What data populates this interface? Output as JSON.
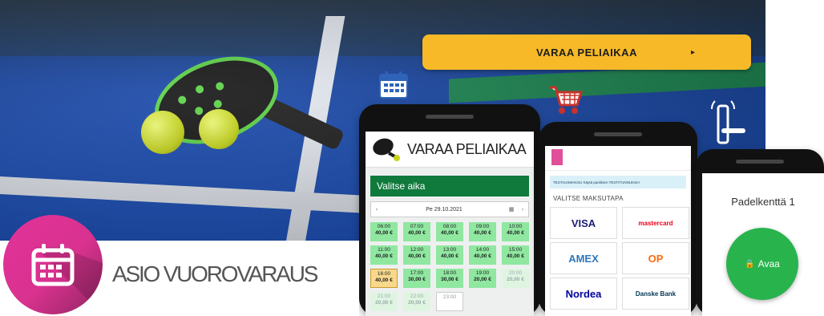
{
  "cta": {
    "label": "VARAA PELIAIKAA",
    "arrow": "▸"
  },
  "brand": {
    "name": "ASIO VUOROVARAUS",
    "accent": "#e2329a"
  },
  "phone_booking": {
    "title": "VARAA PELIAIKAA",
    "choose_label": "Valitse aika",
    "date": "Pe 29.10.2021",
    "prev": "‹",
    "next": "›",
    "slots": [
      {
        "time": "06:00",
        "price": "40,00 €",
        "state": "free"
      },
      {
        "time": "07:00",
        "price": "40,00 €",
        "state": "free"
      },
      {
        "time": "08:00",
        "price": "40,00 €",
        "state": "free"
      },
      {
        "time": "09:00",
        "price": "40,00 €",
        "state": "free"
      },
      {
        "time": "10:00",
        "price": "40,00 €",
        "state": "free"
      },
      {
        "time": "11:00",
        "price": "40,00 €",
        "state": "free"
      },
      {
        "time": "12:00",
        "price": "40,00 €",
        "state": "free"
      },
      {
        "time": "13:00",
        "price": "40,00 €",
        "state": "free"
      },
      {
        "time": "14:00",
        "price": "40,00 €",
        "state": "free"
      },
      {
        "time": "15:00",
        "price": "40,00 €",
        "state": "free"
      },
      {
        "time": "16:00",
        "price": "40,00 €",
        "state": "selected"
      },
      {
        "time": "17:00",
        "price": "30,00 €",
        "state": "free"
      },
      {
        "time": "18:00",
        "price": "30,00 €",
        "state": "free"
      },
      {
        "time": "19:00",
        "price": "20,00 €",
        "state": "free"
      },
      {
        "time": "20:00",
        "price": "20,00 €",
        "state": "dim"
      },
      {
        "time": "21:00",
        "price": "20,00 €",
        "state": "dim"
      },
      {
        "time": "22:00",
        "price": "20,00 €",
        "state": "dim"
      },
      {
        "time": "23:00",
        "price": "",
        "state": "empty"
      }
    ]
  },
  "phone_payment": {
    "alert": "TESTAUSMAKSU Käytä pankkien TESTITUNNUKSIA",
    "section_title": "VALITSE MAKSUTAPA",
    "methods": [
      {
        "name": "VISA",
        "color": "#1a1f71"
      },
      {
        "name": "mastercard",
        "color": "#eb001b"
      },
      {
        "name": "AMEX",
        "color": "#2e77bb"
      },
      {
        "name": "OP",
        "color": "#ff6a10"
      },
      {
        "name": "Nordea",
        "color": "#0000a0"
      },
      {
        "name": "Danske Bank",
        "color": "#003755"
      }
    ]
  },
  "phone_unlock": {
    "title": "Padelkenttä 1",
    "button_label": "Avaa",
    "button_color": "#29b34d"
  },
  "icons": [
    "calendar-icon",
    "shopping-cart-icon",
    "door-lock-icon",
    "app-calendar-icon"
  ]
}
